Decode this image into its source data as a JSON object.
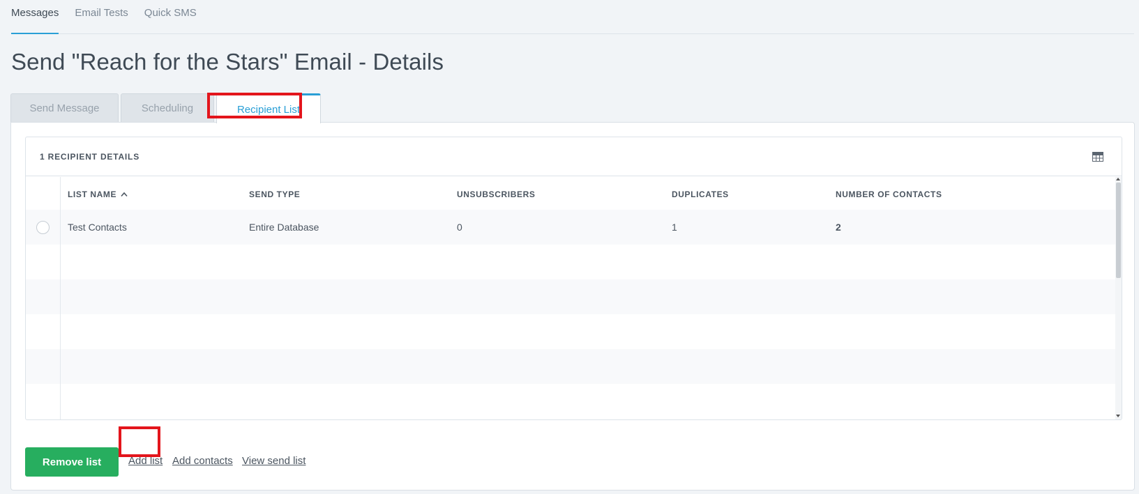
{
  "topnav": {
    "items": [
      {
        "label": "Messages",
        "active": true
      },
      {
        "label": "Email Tests",
        "active": false
      },
      {
        "label": "Quick SMS",
        "active": false
      }
    ]
  },
  "page": {
    "title": "Send \"Reach for the Stars\" Email - Details"
  },
  "tabs": [
    {
      "label": "Send Message",
      "active": false
    },
    {
      "label": "Scheduling",
      "active": false
    },
    {
      "label": "Recipient List",
      "active": true
    }
  ],
  "card": {
    "title": "1 RECIPIENT DETAILS",
    "icon": "grid-view-icon"
  },
  "table": {
    "columns": [
      "LIST NAME",
      "SEND TYPE",
      "UNSUBSCRIBERS",
      "DUPLICATES",
      "NUMBER OF CONTACTS"
    ],
    "sort_icon": "chevron-up-icon",
    "rows": [
      {
        "list_name": "Test Contacts",
        "send_type": "Entire Database",
        "unsubscribers": "0",
        "duplicates": "1",
        "contacts": "2"
      }
    ]
  },
  "actions": {
    "remove_list": "Remove list",
    "add_list": "Add list",
    "add_contacts": "Add contacts",
    "view_send_list": "View send list"
  },
  "colors": {
    "accent": "#2a9fd6",
    "primary_button": "#27ae5f",
    "highlight": "#e3151c",
    "background": "#f1f4f7"
  }
}
